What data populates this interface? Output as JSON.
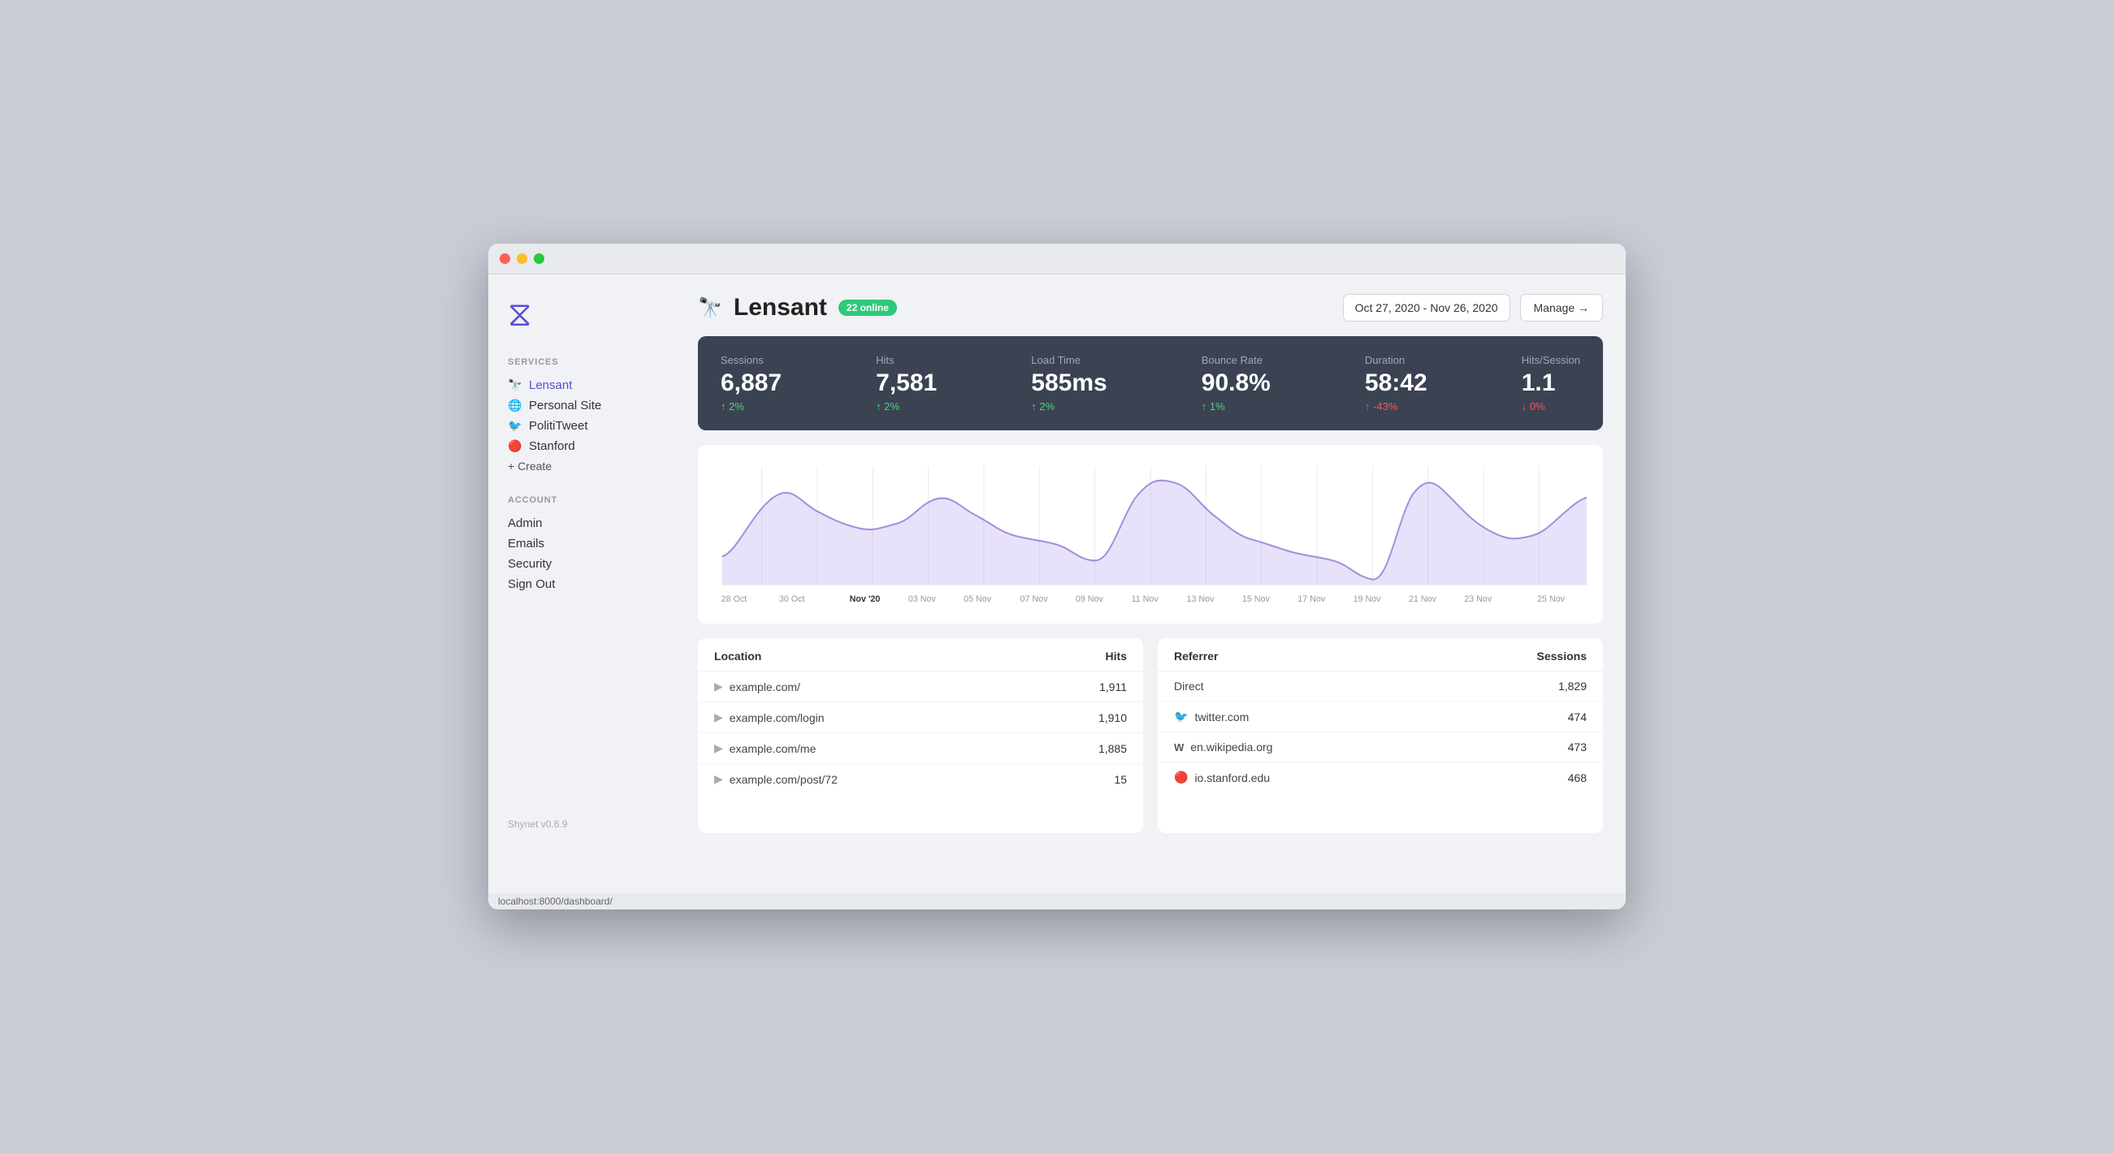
{
  "window": {
    "url_bar": "localhost:8000/dashboard/"
  },
  "sidebar": {
    "services_label": "SERVICES",
    "account_label": "ACCOUNT",
    "items_services": [
      {
        "id": "lensant",
        "label": "Lensant",
        "icon": "🔭",
        "active": true
      },
      {
        "id": "personal-site",
        "label": "Personal Site",
        "icon": "🌐",
        "active": false
      },
      {
        "id": "polititweet",
        "label": "PolitiTweet",
        "icon": "🐦",
        "active": false
      },
      {
        "id": "stanford",
        "label": "Stanford",
        "icon": "🔴",
        "active": false
      }
    ],
    "create_label": "+ Create",
    "items_account": [
      {
        "id": "admin",
        "label": "Admin"
      },
      {
        "id": "emails",
        "label": "Emails"
      },
      {
        "id": "security",
        "label": "Security"
      },
      {
        "id": "sign-out",
        "label": "Sign Out"
      }
    ],
    "version": "Shynet v0.6.9"
  },
  "header": {
    "app_icon": "🔭",
    "title": "Lensant",
    "online_badge": "22 online",
    "date_range": "Oct 27, 2020 - Nov 26, 2020",
    "manage_btn": "Manage →"
  },
  "stats": [
    {
      "label": "Sessions",
      "value": "6,887",
      "change": "↑ 2%",
      "direction": "up"
    },
    {
      "label": "Hits",
      "value": "7,581",
      "change": "↑ 2%",
      "direction": "up"
    },
    {
      "label": "Load Time",
      "value": "585ms",
      "change": "↑ 2%",
      "direction": "up"
    },
    {
      "label": "Bounce Rate",
      "value": "90.8%",
      "change": "↑ 1%",
      "direction": "up"
    },
    {
      "label": "Duration",
      "value": "58:42",
      "change": "↑ -43%",
      "direction": "neg"
    },
    {
      "label": "Hits/Session",
      "value": "1.1",
      "change": "↓ 0%",
      "direction": "down"
    }
  ],
  "chart": {
    "x_labels": [
      "28 Oct",
      "30 Oct",
      "Nov '20",
      "03 Nov",
      "05 Nov",
      "07 Nov",
      "09 Nov",
      "11 Nov",
      "13 Nov",
      "15 Nov",
      "17 Nov",
      "19 Nov",
      "21 Nov",
      "23 Nov",
      "25 Nov"
    ],
    "bold_label_index": 2
  },
  "location_table": {
    "col1": "Location",
    "col2": "Hits",
    "rows": [
      {
        "url": "example.com/",
        "hits": "1,911"
      },
      {
        "url": "example.com/login",
        "hits": "1,910"
      },
      {
        "url": "example.com/me",
        "hits": "1,885"
      },
      {
        "url": "example.com/post/72",
        "hits": "15"
      }
    ]
  },
  "referrer_table": {
    "col1": "Referrer",
    "col2": "Sessions",
    "rows": [
      {
        "source": "Direct",
        "icon": "none",
        "sessions": "1,829"
      },
      {
        "source": "twitter.com",
        "icon": "twitter",
        "sessions": "474"
      },
      {
        "source": "en.wikipedia.org",
        "icon": "wiki",
        "sessions": "473"
      },
      {
        "source": "io.stanford.edu",
        "icon": "stanford",
        "sessions": "468"
      }
    ]
  }
}
